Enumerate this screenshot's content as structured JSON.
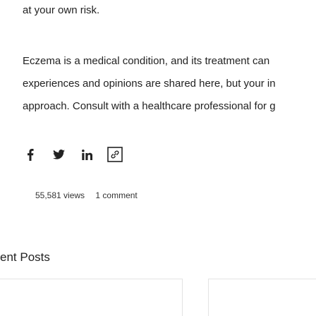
{
  "article": {
    "risk_line": "at your own risk.",
    "disclaimer_line_1": "Eczema is a medical condition, and its treatment can",
    "disclaimer_line_2": "experiences and opinions are shared here, but your in",
    "disclaimer_line_3": "approach. Consult with a healthcare professional for g"
  },
  "share": {
    "icons": [
      "facebook-icon",
      "twitter-icon",
      "linkedin-icon",
      "link-icon"
    ],
    "icon_color": "#222222"
  },
  "stats": {
    "views": "55,581 views",
    "comments": "1 comment"
  },
  "recent_posts": {
    "heading": "ent Posts"
  }
}
